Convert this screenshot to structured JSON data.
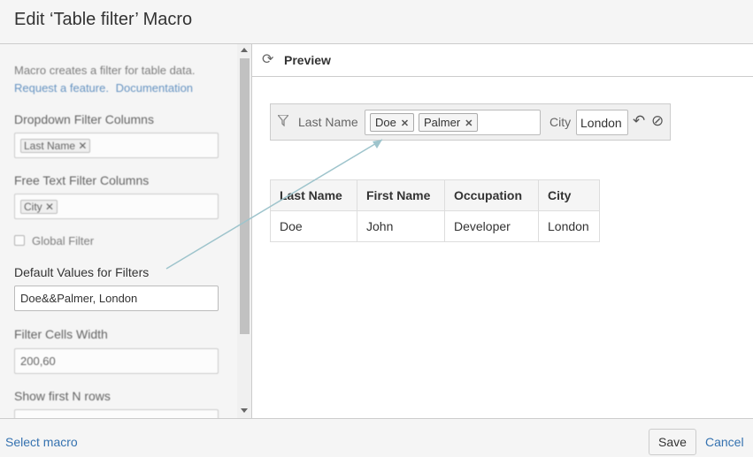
{
  "dialog": {
    "title": "Edit ‘Table filter’ Macro"
  },
  "left_panel": {
    "description": "Macro creates a filter for table data.",
    "links": [
      "Request a feature.",
      "Documentation"
    ],
    "dropdown_columns": {
      "label": "Dropdown Filter Columns",
      "tag": "Last Name"
    },
    "free_text_columns": {
      "label": "Free Text Filter Columns",
      "tag": "City"
    },
    "global_filter": {
      "label": "Global Filter",
      "checked": false
    },
    "default_values": {
      "label": "Default Values for Filters",
      "value": "Doe&&Palmer, London"
    },
    "cell_width": {
      "label": "Filter Cells Width",
      "value": "200,60"
    },
    "first_rows": {
      "label": "Show first N rows"
    }
  },
  "preview": {
    "title": "Preview",
    "filter": {
      "label1": "Last Name",
      "tags": [
        "Doe",
        "Palmer"
      ],
      "label2": "City",
      "city_value": "London"
    },
    "table": {
      "headers": [
        "Last Name",
        "First Name",
        "Occupation",
        "City"
      ],
      "rows": [
        [
          "Doe",
          "John",
          "Developer",
          "London"
        ]
      ]
    }
  },
  "footer": {
    "select_macro": "Select macro",
    "save": "Save",
    "cancel": "Cancel"
  },
  "colors": {
    "link": "#3572b0",
    "arrow": "#9ec4cc"
  },
  "icons": {
    "refresh": "refresh-icon",
    "filter": "funnel-icon",
    "undo": "undo-icon",
    "clear": "clear-icon",
    "remove": "close-icon"
  }
}
